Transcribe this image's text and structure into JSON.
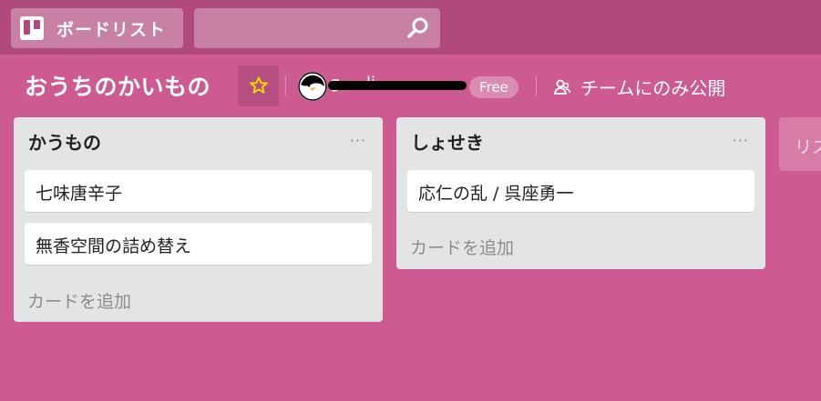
{
  "header": {
    "boards_label": "ボードリスト",
    "search_value": ""
  },
  "board": {
    "title": "おうちのかいもの",
    "team_name": "g  ...  li",
    "team_badge": "Free",
    "visibility": "チームにのみ公開"
  },
  "lists": [
    {
      "title": "かうもの",
      "menu": "···",
      "cards": [
        "七味唐辛子",
        "無香空間の詰め替え"
      ],
      "add_card": "カードを追加"
    },
    {
      "title": "しょせき",
      "menu": "···",
      "cards": [
        "応仁の乱 / 呉座勇一"
      ],
      "add_card": "カードを追加"
    }
  ],
  "add_list_label": "リストを追加",
  "colors": {
    "board_bg": "#cd5a91",
    "header_bg": "#b04a7d",
    "star": "#f2d600"
  }
}
